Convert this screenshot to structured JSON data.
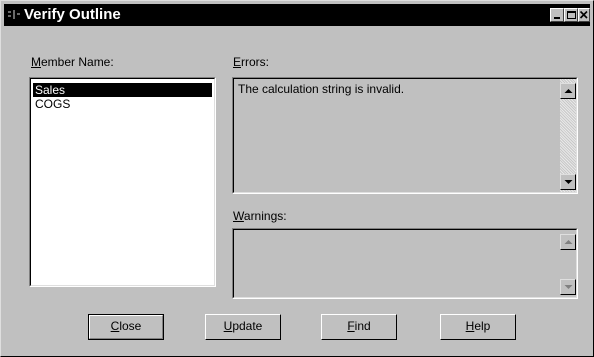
{
  "window": {
    "title": "Verify Outline",
    "controls": [
      "minimize-icon",
      "maximize-icon",
      "close-icon"
    ]
  },
  "member_name": {
    "label_accel": "M",
    "label_rest": "ember Name:",
    "items": [
      "Sales",
      "COGS"
    ],
    "selected": "Sales"
  },
  "errors": {
    "label_accel": "E",
    "label_rest": "rrors:",
    "text": "The calculation string is invalid."
  },
  "warnings": {
    "label_accel": "W",
    "label_rest": "arnings:",
    "text": ""
  },
  "buttons": {
    "close": {
      "accel": "C",
      "rest": "lose"
    },
    "update": {
      "accel": "U",
      "rest": "pdate"
    },
    "find": {
      "accel": "F",
      "rest": "ind"
    },
    "help": {
      "accel": "H",
      "rest": "elp"
    }
  }
}
